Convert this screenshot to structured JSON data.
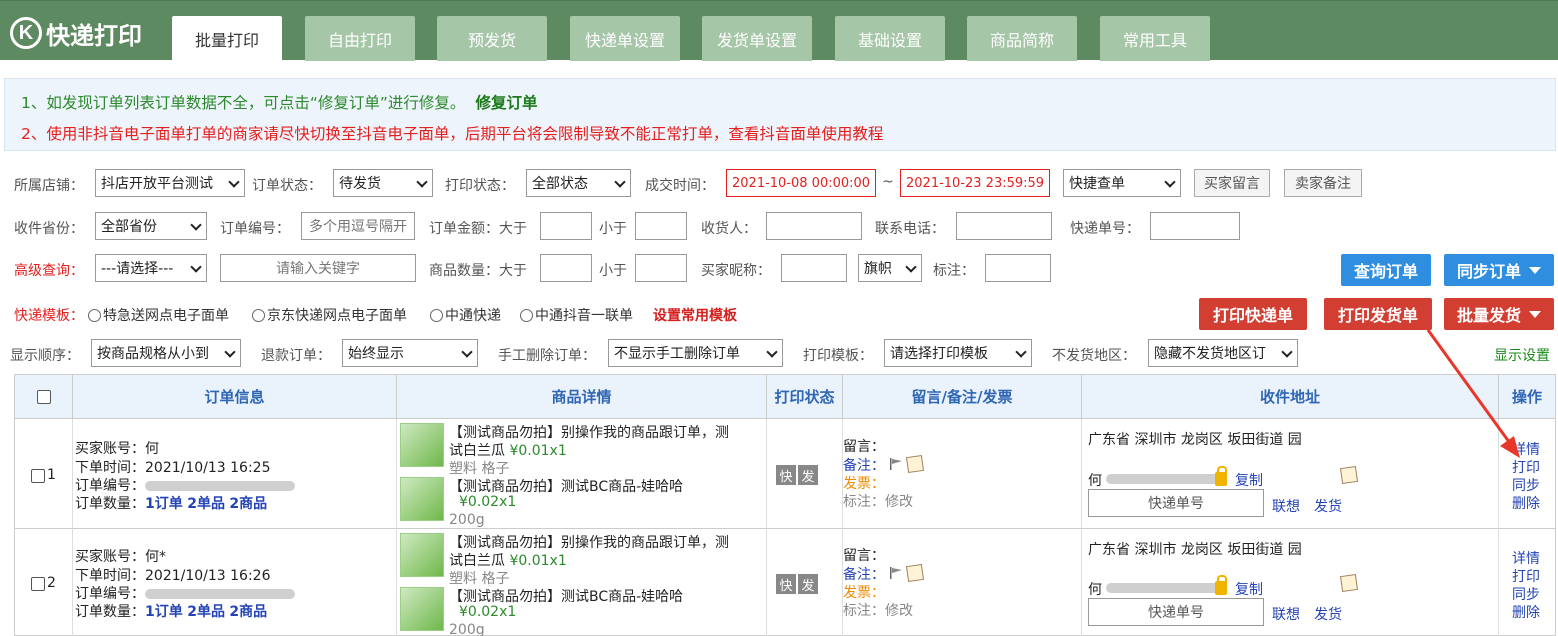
{
  "app": {
    "logo_letter": "K",
    "logo_text": "快递打印"
  },
  "tabs": [
    "批量打印",
    "自由打印",
    "预发货",
    "快递单设置",
    "发货单设置",
    "基础设置",
    "商品简称",
    "常用工具"
  ],
  "notice": {
    "line1": "1、如发现订单列表订单数据不全，可点击“修复订单”进行修复。",
    "line1_link": "修复订单",
    "line2": "2、使用非抖音电子面单打单的商家请尽快切换至抖音电子面单，后期平台将会限制导致不能正常打单，查看抖音面单使用教程"
  },
  "filters": {
    "shop_label": "所属店铺：",
    "shop_value": "抖店开放平台测试",
    "order_status_label": "订单状态：",
    "order_status_value": "待发货",
    "print_status_label": "打印状态：",
    "print_status_value": "全部状态",
    "deal_time_label": "成交时间：",
    "time_from": "2021-10-08 00:00:00",
    "time_sep": "~",
    "time_to": "2021-10-23 23:59:59",
    "quick_query_value": "快捷查单",
    "buyer_msg_btn": "买家留言",
    "seller_note_btn": "卖家备注",
    "province_label": "收件省份：",
    "province_value": "全部省份",
    "order_no_label": "订单编号：",
    "order_no_placeholder": "多个用逗号隔开",
    "amount_label": "订单金额：大于",
    "less_than": "小于",
    "receiver_label": "收货人：",
    "phone_label": "联系电话：",
    "tracking_label": "快递单号：",
    "adv_label": "高级查询：",
    "adv_value": "---请选择---",
    "keyword_placeholder": "请输入关键字",
    "qty_label": "商品数量：大于",
    "qty_less": "小于",
    "nick_label": "买家昵称：",
    "flag_value": "旗帜",
    "mark_label": "标注：",
    "query_btn": "查询订单",
    "sync_btn": "同步订单"
  },
  "templates": {
    "label": "快递模板：",
    "options": [
      "特急送网点电子面单",
      "京东快递网点电子面单",
      "中通快递",
      "中通抖音一联单"
    ],
    "set_link": "设置常用模板",
    "print_express_btn": "打印快递单",
    "print_invoice_btn": "打印发货单",
    "batch_ship_btn": "批量发货"
  },
  "display": {
    "order_label": "显示顺序：",
    "order_value": "按商品规格从小到",
    "refund_label": "退款订单：",
    "refund_value": "始终显示",
    "manual_del_label": "手工删除订单：",
    "manual_del_value": "不显示手工删除订单",
    "print_tpl_label": "打印模板：",
    "print_tpl_value": "请选择打印模板",
    "no_ship_label": "不发货地区：",
    "no_ship_value": "隐藏不发货地区订",
    "settings_link": "显示设置"
  },
  "table": {
    "headers": [
      "订单信息",
      "商品详情",
      "打印状态",
      "留言/备注/发票",
      "收件地址",
      "操作"
    ],
    "rows": [
      {
        "index": "1",
        "buyer_label": "买家账号：",
        "buyer": "何",
        "time_label": "下单时间：",
        "time": "2021/10/13 16:25",
        "no_label": "订单编号：",
        "qty_label": "订单数量：",
        "orders": "1订单",
        "items": "2单品",
        "goods": "2商品",
        "products": [
          {
            "name": "【测试商品勿拍】别操作我的商品跟订单，测试白兰瓜",
            "price": "¥0.01x1",
            "spec": "塑料 格子"
          },
          {
            "name": "【测试商品勿拍】测试BC商品-娃哈哈",
            "price": "¥0.02x1",
            "spec": "200g"
          }
        ],
        "print_tags": [
          "快",
          "发"
        ],
        "msg_label": "留言：",
        "note_label": "备注：",
        "invoice_label": "发票：",
        "mark_label": "标注：",
        "mark_action": "修改",
        "address": "广东省 深圳市 龙岗区 坂田街道 园",
        "name": "何",
        "copy": "复制",
        "tracking_placeholder": "快递单号",
        "lianxiang": "联想",
        "ship": "发货",
        "ops": [
          "详情",
          "打印",
          "同步",
          "删除"
        ]
      },
      {
        "index": "2",
        "buyer_label": "买家账号：",
        "buyer": "何*",
        "time_label": "下单时间：",
        "time": "2021/10/13 16:26",
        "no_label": "订单编号：",
        "qty_label": "订单数量：",
        "orders": "1订单",
        "items": "2单品",
        "goods": "2商品",
        "products": [
          {
            "name": "【测试商品勿拍】别操作我的商品跟订单，测试白兰瓜",
            "price": "¥0.01x1",
            "spec": "塑料 格子"
          },
          {
            "name": "【测试商品勿拍】测试BC商品-娃哈哈",
            "price": "¥0.02x1",
            "spec": "200g"
          }
        ],
        "print_tags": [
          "快",
          "发"
        ],
        "msg_label": "留言：",
        "note_label": "备注：",
        "invoice_label": "发票：",
        "mark_label": "标注：",
        "mark_action": "修改",
        "address": "广东省 深圳市 龙岗区 坂田街道 园",
        "name": "何",
        "copy": "复制",
        "tracking_placeholder": "快递单号",
        "lianxiang": "联想",
        "ship": "发货",
        "ops": [
          "详情",
          "打印",
          "同步",
          "删除"
        ]
      }
    ]
  },
  "colors": {
    "header_bg": "#5e8a62",
    "tab_bg": "#a6c6a8",
    "primary_blue": "#2f8ee0",
    "danger_red": "#d23f32",
    "link_blue": "#2444b5",
    "arrow_red": "#e8362a"
  }
}
